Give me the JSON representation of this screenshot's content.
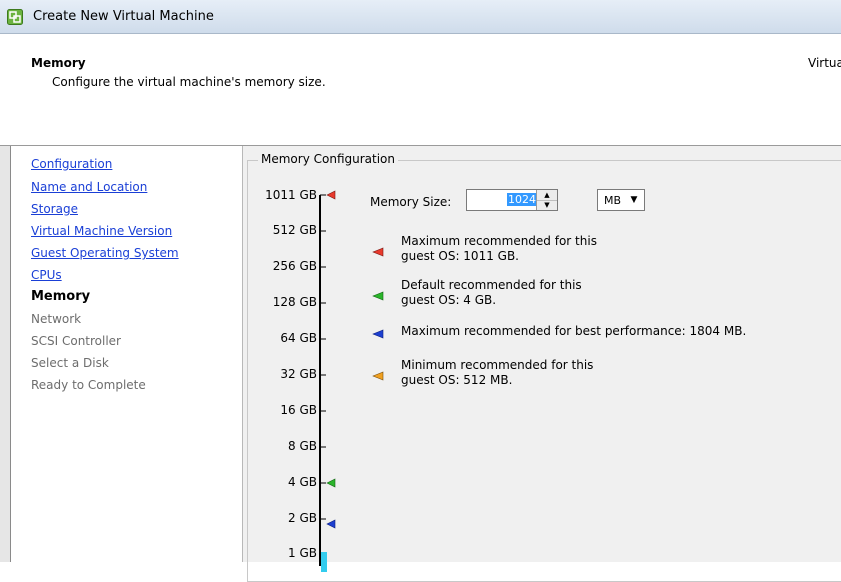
{
  "window": {
    "title": "Create New Virtual Machine"
  },
  "header": {
    "title": "Memory",
    "description": "Configure the virtual machine's memory size.",
    "right_text": "Virtua"
  },
  "nav": {
    "items": [
      {
        "label": "Configuration",
        "state": "link"
      },
      {
        "label": "Name and Location",
        "state": "link"
      },
      {
        "label": "Storage",
        "state": "link"
      },
      {
        "label": "Virtual Machine Version",
        "state": "link"
      },
      {
        "label": "Guest Operating System",
        "state": "link"
      },
      {
        "label": "CPUs",
        "state": "link"
      },
      {
        "label": "Memory",
        "state": "current"
      },
      {
        "label": "Network",
        "state": "disabled"
      },
      {
        "label": "SCSI Controller",
        "state": "disabled"
      },
      {
        "label": "Select a Disk",
        "state": "disabled"
      },
      {
        "label": "Ready to Complete",
        "state": "disabled"
      }
    ]
  },
  "memory_config": {
    "group_label": "Memory Configuration",
    "scale_ticks": [
      "1011 GB",
      "512 GB",
      "256 GB",
      "128 GB",
      "64 GB",
      "32 GB",
      "16 GB",
      "8 GB",
      "4 GB",
      "2 GB",
      "1 GB"
    ],
    "memory_size_label": "Memory Size:",
    "memory_size_value": "1024",
    "unit": "MB",
    "recommendations": [
      {
        "line1": "Maximum recommended for this",
        "line2": "guest OS: 1011 GB.",
        "color": "#e8392c"
      },
      {
        "line1": "Default recommended for this",
        "line2": "guest OS: 4 GB.",
        "color": "#2bb52b"
      },
      {
        "line1": "Maximum recommended for best performance: 1804 MB.",
        "line2": "",
        "color": "#1c3fd0"
      },
      {
        "line1": "Minimum recommended for this",
        "line2": "guest OS: 512 MB.",
        "color": "#f0a020"
      }
    ],
    "slider_fill_color": "#33ccee"
  }
}
